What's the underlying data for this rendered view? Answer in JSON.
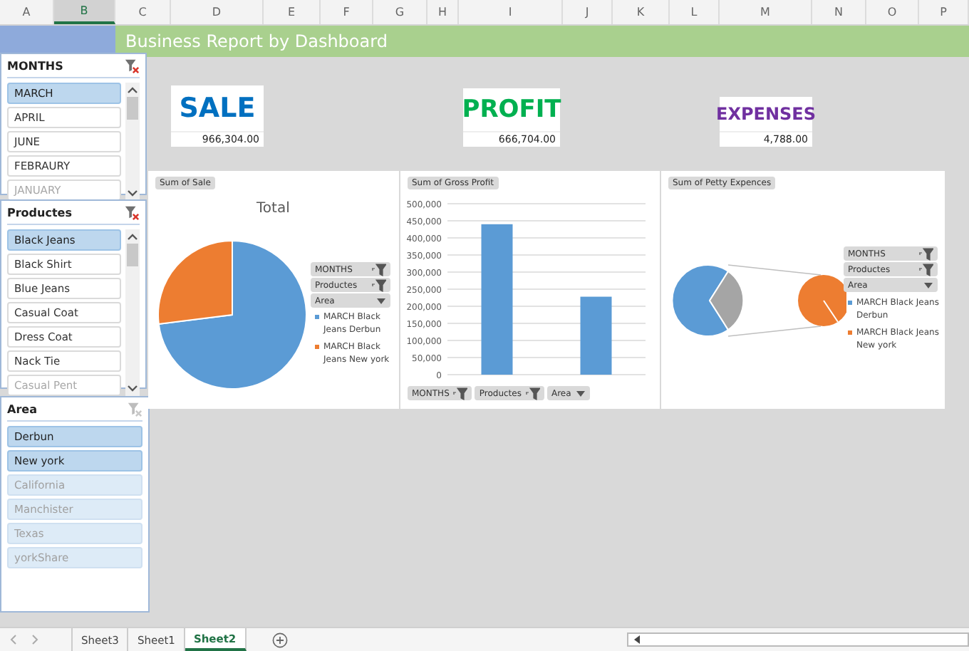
{
  "columns": [
    {
      "label": "A",
      "selected": false
    },
    {
      "label": "B",
      "selected": true
    },
    {
      "label": "C",
      "selected": false
    },
    {
      "label": "D",
      "selected": false
    },
    {
      "label": "E",
      "selected": false
    },
    {
      "label": "F",
      "selected": false
    },
    {
      "label": "G",
      "selected": false
    },
    {
      "label": "H",
      "selected": false
    },
    {
      "label": "I",
      "selected": false
    },
    {
      "label": "J",
      "selected": false
    },
    {
      "label": "K",
      "selected": false
    },
    {
      "label": "L",
      "selected": false
    },
    {
      "label": "M",
      "selected": false
    },
    {
      "label": "N",
      "selected": false
    },
    {
      "label": "O",
      "selected": false
    },
    {
      "label": "P",
      "selected": false
    }
  ],
  "banner": "Business Report by Dashboard",
  "slicers": [
    {
      "title": "MONTHS",
      "filtered": true,
      "items": [
        {
          "label": "MARCH",
          "selected": true,
          "has_data": true
        },
        {
          "label": "APRIL",
          "selected": false,
          "has_data": true
        },
        {
          "label": "JUNE",
          "selected": false,
          "has_data": true
        },
        {
          "label": "FEBRAURY",
          "selected": false,
          "has_data": true
        },
        {
          "label": "JANUARY",
          "selected": false,
          "has_data": false
        }
      ]
    },
    {
      "title": "Productes",
      "filtered": true,
      "items": [
        {
          "label": "Black Jeans",
          "selected": true,
          "has_data": true
        },
        {
          "label": "Black Shirt",
          "selected": false,
          "has_data": true
        },
        {
          "label": "Blue Jeans",
          "selected": false,
          "has_data": true
        },
        {
          "label": "Casual Coat",
          "selected": false,
          "has_data": true
        },
        {
          "label": "Dress Coat",
          "selected": false,
          "has_data": true
        },
        {
          "label": "Nack Tie",
          "selected": false,
          "has_data": true
        },
        {
          "label": "Casual Pent",
          "selected": false,
          "has_data": false
        }
      ]
    },
    {
      "title": "Area",
      "filtered": false,
      "items": [
        {
          "label": "Derbun",
          "selected": true,
          "has_data": true
        },
        {
          "label": "New york",
          "selected": true,
          "has_data": true
        },
        {
          "label": "California",
          "selected": true,
          "has_data": false
        },
        {
          "label": "Manchister",
          "selected": true,
          "has_data": false
        },
        {
          "label": "Texas",
          "selected": true,
          "has_data": false
        },
        {
          "label": "yorkShare",
          "selected": true,
          "has_data": false
        }
      ]
    }
  ],
  "kpis": [
    {
      "label": "SALE",
      "value": "966,304.00",
      "color": "#0070c0"
    },
    {
      "label": "PROFIT",
      "value": "666,704.00",
      "color": "#00b050"
    },
    {
      "label": "EXPENSES",
      "value": "4,788.00",
      "color": "#7030a0"
    }
  ],
  "charts": [
    {
      "kind": "pie",
      "button": "Sum of Sale",
      "title": "Total",
      "field_buttons": [
        {
          "label": "MONTHS",
          "filtered": true
        },
        {
          "label": "Productes",
          "filtered": true
        },
        {
          "label": "Area",
          "filtered": false
        }
      ],
      "legend": [
        {
          "label": "MARCH Black Jeans Derbun",
          "color": "#5b9bd5"
        },
        {
          "label": "MARCH Black Jeans New york",
          "color": "#ed7d31"
        }
      ]
    },
    {
      "kind": "bar",
      "button": "Sum of Gross Profit",
      "field_buttons": [
        {
          "label": "MONTHS",
          "filtered": true
        },
        {
          "label": "Productes",
          "filtered": true
        },
        {
          "label": "Area",
          "filtered": false
        }
      ],
      "chart_data": {
        "type": "bar",
        "grid": true,
        "values": [
          440000,
          228000
        ],
        "ylim": [
          0,
          500000
        ],
        "yticks": [
          {
            "value": 0,
            "label": "0"
          },
          {
            "value": 50000,
            "label": "50,000"
          },
          {
            "value": 100000,
            "label": "100,000"
          },
          {
            "value": 150000,
            "label": "150,000"
          },
          {
            "value": 200000,
            "label": "200,000"
          },
          {
            "value": 250000,
            "label": "250,000"
          },
          {
            "value": 300000,
            "label": "300,000"
          },
          {
            "value": 350000,
            "label": "350,000"
          },
          {
            "value": 400000,
            "label": "400,000"
          },
          {
            "value": 450000,
            "label": "450,000"
          },
          {
            "value": 500000,
            "label": "500,000"
          }
        ]
      }
    },
    {
      "kind": "pie_of_pie",
      "button": "Sum of Petty Expences",
      "field_buttons": [
        {
          "label": "MONTHS",
          "filtered": true
        },
        {
          "label": "Productes",
          "filtered": true
        },
        {
          "label": "Area",
          "filtered": false
        }
      ],
      "legend": [
        {
          "label": "MARCH Black Jeans Derbun",
          "color": "#5b9bd5"
        },
        {
          "label": "MARCH Black Jeans New york",
          "color": "#ed7d31"
        }
      ]
    }
  ],
  "sheet_tabs": [
    {
      "label": "Sheet3",
      "selected": false
    },
    {
      "label": "Sheet1",
      "selected": false
    },
    {
      "label": "Sheet2",
      "selected": true
    }
  ]
}
